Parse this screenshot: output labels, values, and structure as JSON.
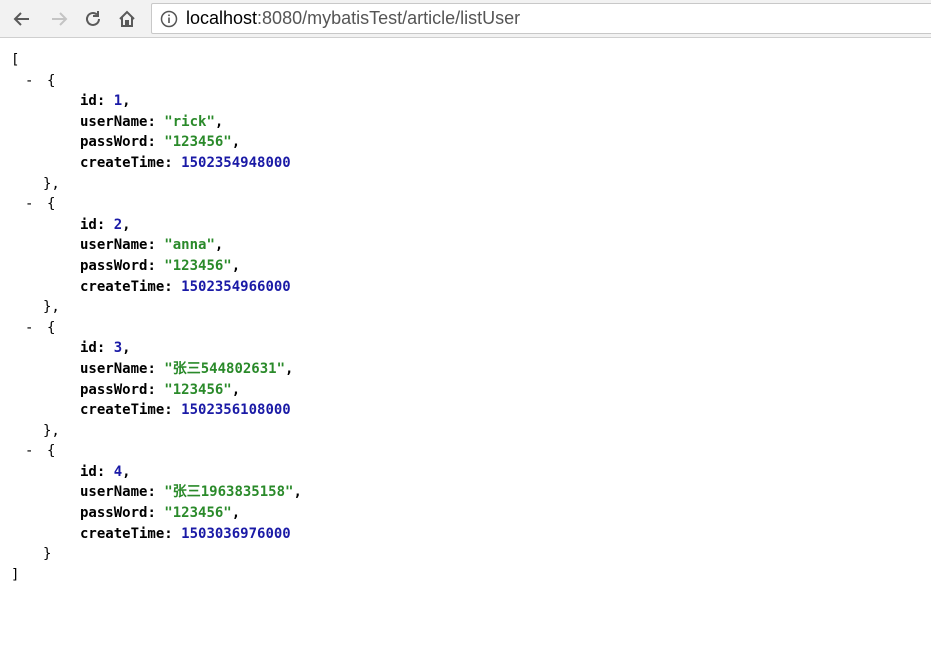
{
  "browser": {
    "url_host": "localhost",
    "url_rest": ":8080/mybatisTest/article/listUser"
  },
  "json": {
    "open_bracket": "[",
    "close_bracket": "]",
    "collapse_symbol": "-",
    "users": [
      {
        "id": "1",
        "userName": "\"rick\"",
        "passWord": "\"123456\"",
        "createTime": "1502354948000"
      },
      {
        "id": "2",
        "userName": "\"anna\"",
        "passWord": "\"123456\"",
        "createTime": "1502354966000"
      },
      {
        "id": "3",
        "userName": "\"张三544802631\"",
        "passWord": "\"123456\"",
        "createTime": "1502356108000"
      },
      {
        "id": "4",
        "userName": "\"张三1963835158\"",
        "passWord": "\"123456\"",
        "createTime": "1503036976000"
      }
    ],
    "keys": {
      "id": "id",
      "userName": "userName",
      "passWord": "passWord",
      "createTime": "createTime"
    }
  },
  "colors": {
    "number": "#1a1aa6",
    "string": "#2a8a2a"
  }
}
